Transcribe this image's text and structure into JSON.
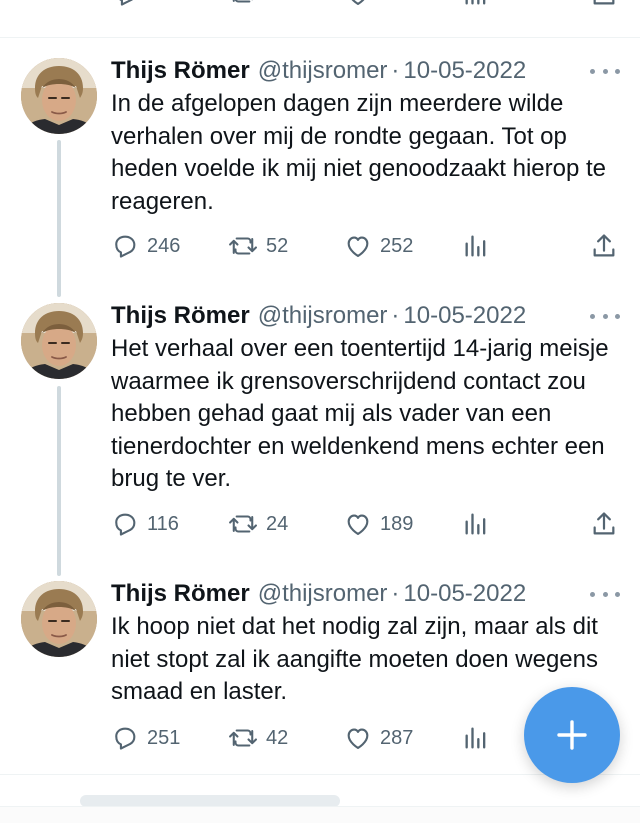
{
  "tweets": [
    {
      "author": {
        "name": "Thijs Römer",
        "handle": "@thijsromer"
      },
      "separator": "·",
      "date": "10-05-2022",
      "text": "In de afgelopen dagen zijn meerdere wilde verhalen over mij de rondte gegaan. Tot op heden voelde ik mij niet genoodzaakt hierop te reageren.",
      "replies": "246",
      "retweets": "52",
      "likes": "252"
    },
    {
      "author": {
        "name": "Thijs Römer",
        "handle": "@thijsromer"
      },
      "separator": "·",
      "date": "10-05-2022",
      "text": "Het verhaal over een toentertijd 14-jarig meisje waarmee ik grensoverschrijdend contact zou hebben gehad gaat mij als vader van een tienerdochter en weldenkend mens echter een brug te ver.",
      "replies": "116",
      "retweets": "24",
      "likes": "189"
    },
    {
      "author": {
        "name": "Thijs Römer",
        "handle": "@thijsromer"
      },
      "separator": "·",
      "date": "10-05-2022",
      "text": "Ik hoop niet dat het nodig zal zijn, maar als dit niet stopt zal ik aangifte moeten doen wegens smaad en laster.",
      "replies": "251",
      "retweets": "42",
      "likes": "287"
    }
  ],
  "icons": {
    "reply": "reply-icon",
    "retweet": "retweet-icon",
    "like": "heart-icon",
    "views": "analytics-icon",
    "share": "share-icon",
    "more": "more-icon",
    "compose": "plus-icon"
  },
  "colors": {
    "accent": "#4a99e9",
    "text": "#0f1419",
    "secondary": "#536471",
    "thread_line": "#cfd9de",
    "divider": "#eff3f4"
  }
}
